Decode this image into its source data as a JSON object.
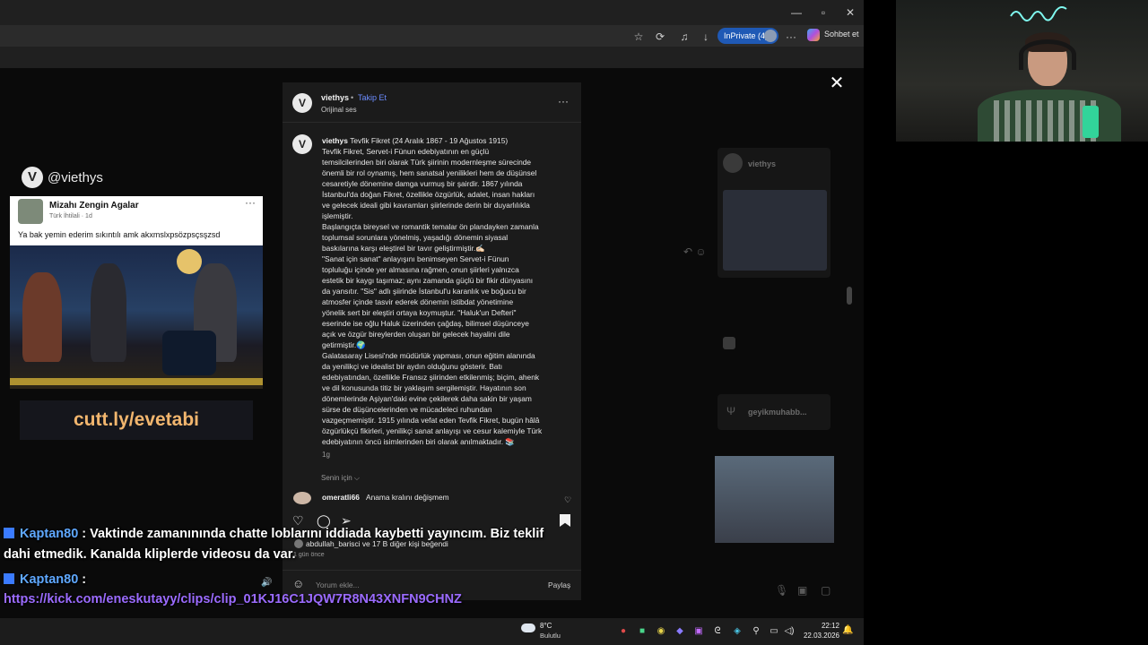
{
  "browser": {
    "inprivate_label": "InPrivate (4)",
    "copilot_label": "Sohbet et"
  },
  "reel": {
    "channel_handle": "@viethys",
    "tweet_name": "Mizahı Zengin Agalar",
    "tweet_sub": "Türk İhtilali · 1d",
    "tweet_text": "Ya bak yemin ederim sıkıntılı amk akxmslxpsözpsçsşzsd",
    "banner_text": "cutt.ly/evetabi"
  },
  "instagram": {
    "username": "viethys",
    "separator": "•",
    "follow_label": "Takip Et",
    "audio_label": "Orijinal ses",
    "caption_user": "viethys",
    "caption_lines": [
      "Tevfik Fikret (24 Aralık 1867 - 19 Ağustos 1915)",
      "Tevfik Fikret, Servet-i Fünun edebiyatının en güçlü",
      "temsilcilerinden biri olarak Türk şiirinin modernleşme sürecinde",
      "önemli bir rol oynamış, hem sanatsal yenilikleri hem de düşünsel",
      "cesaretiyle dönemine damga vurmuş bir şairdir. 1867 yılında",
      "İstanbul'da doğan Fikret, özellikle özgürlük, adalet, insan hakları",
      "ve gelecek ideali gibi kavramları şiirlerinde derin bir duyarlılıkla",
      "işlemiştir.",
      "Başlangıçta bireysel ve romantik temalar ön plandayken zamanla",
      "toplumsal sorunlara yönelmiş, yaşadığı dönemin siyasal",
      "baskılarına karşı eleştirel bir tavır geliştirmiştir.✍🏻",
      "\"Sanat için sanat\" anlayışını benimseyen Servet-i Fünun",
      "topluluğu içinde yer almasına rağmen, onun şiirleri yalnızca",
      "estetik bir kaygı taşımaz; aynı zamanda güçlü bir fikir dünyasını",
      "da yansıtır. \"Sis\" adlı şiirinde İstanbul'u karanlık ve boğucu bir",
      "atmosfer içinde tasvir ederek dönemin istibdat yönetimine",
      "yönelik sert bir eleştiri ortaya koymuştur. \"Haluk'un Defteri\"",
      "eserinde ise oğlu Haluk üzerinden çağdaş, bilimsel düşünceye",
      "açık ve özgür bireylerden oluşan bir gelecek hayalini dile",
      "getirmiştir.🌍",
      "Galatasaray Lisesi'nde müdürlük yapması, onun eğitim alanında",
      "da yenilikçi ve idealist bir aydın olduğunu gösterir. Batı",
      "edebiyatından, özellikle Fransız şiirinden etkilenmiş; biçim, ahenk",
      "ve dil konusunda titiz bir yaklaşım sergilemiştir. Hayatının son",
      "dönemlerinde Aşiyan'daki evine çekilerek daha sakin bir yaşam",
      "sürse de düşüncelerinden ve mücadeleci ruhundan",
      "vazgeçmemiştir. 1915 yılında vefat eden Tevfik Fikret, bugün hâlâ",
      "özgürlükçü fikirleri, yenilikçi sanat anlayışı ve cesur kalemiyle Türk",
      "edebiyatının öncü isimlerinden biri olarak anılmaktadır. 📚"
    ],
    "caption_time": "1g",
    "for_you_label": "Senin için ⌵",
    "comment_user": "omeratli66",
    "comment_text": "Anama kralını değişmem",
    "likes_text": "abdullah_barisci ve 17 B diğer kişi beğendi",
    "post_age": "1 gün önce",
    "comment_placeholder": "Yorum ekle...",
    "share_label": "Paylaş",
    "right_user_1": "viethys",
    "right_user_2": "geyikmuhabb..."
  },
  "chat": {
    "msg1_user": "Kaptan80",
    "msg1_line1": " : Vaktinde zamanınında chatte loblarını iddiada kaybetti yayıncım. Biz teklif",
    "msg1_line2": "dahi etmedik. Kanalda kliplerde videosu da var.",
    "msg2_user": "Kaptan80",
    "msg2_colon": " :",
    "msg2_link": "https://kick.com/eneskutayy/clips/clip_01KJ16C1JQW7R8N43XNFN9CHNZ"
  },
  "taskbar": {
    "temp": "8°C",
    "weather": "Bulutlu",
    "time": "22:12",
    "date": "22.03.2026"
  },
  "icons": [
    "minimize-icon",
    "maximize-icon",
    "close-icon",
    "star-icon",
    "extensions-icon",
    "music-icon",
    "download-icon",
    "more-icon",
    "heart-icon",
    "comment-icon",
    "share-icon",
    "bookmark-icon",
    "emoji-icon",
    "speaker-icon",
    "bell-icon"
  ]
}
